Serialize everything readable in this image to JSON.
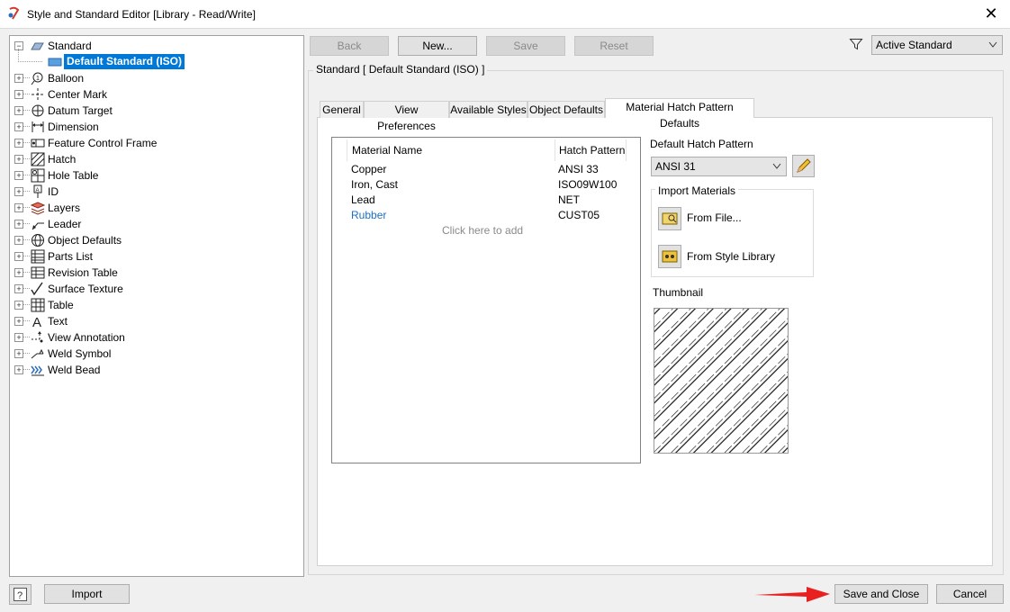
{
  "window": {
    "title": "Style and Standard Editor [Library - Read/Write]",
    "close_glyph": "✕"
  },
  "tree": {
    "root": {
      "label": "Standard",
      "icon": "standard-icon"
    },
    "selected_child": {
      "label": "Default Standard (ISO)",
      "icon": "default-standard-icon"
    },
    "items": [
      {
        "label": "Balloon",
        "icon": "balloon-icon"
      },
      {
        "label": "Center Mark",
        "icon": "center-mark-icon"
      },
      {
        "label": "Datum Target",
        "icon": "datum-target-icon"
      },
      {
        "label": "Dimension",
        "icon": "dimension-icon"
      },
      {
        "label": "Feature Control Frame",
        "icon": "feature-control-frame-icon"
      },
      {
        "label": "Hatch",
        "icon": "hatch-icon"
      },
      {
        "label": "Hole Table",
        "icon": "hole-table-icon"
      },
      {
        "label": "ID",
        "icon": "id-icon"
      },
      {
        "label": "Layers",
        "icon": "layers-icon"
      },
      {
        "label": "Leader",
        "icon": "leader-icon"
      },
      {
        "label": "Object Defaults",
        "icon": "object-defaults-icon"
      },
      {
        "label": "Parts List",
        "icon": "parts-list-icon"
      },
      {
        "label": "Revision Table",
        "icon": "revision-table-icon"
      },
      {
        "label": "Surface Texture",
        "icon": "surface-texture-icon"
      },
      {
        "label": "Table",
        "icon": "table-icon"
      },
      {
        "label": "Text",
        "icon": "text-icon"
      },
      {
        "label": "View Annotation",
        "icon": "view-annotation-icon"
      },
      {
        "label": "Weld Symbol",
        "icon": "weld-symbol-icon"
      },
      {
        "label": "Weld Bead",
        "icon": "weld-bead-icon"
      }
    ]
  },
  "toolbar": {
    "back": "Back",
    "new": "New...",
    "save": "Save",
    "reset": "Reset",
    "filter_value": "Active Standard"
  },
  "panel": {
    "group_title": "Standard [ Default Standard (ISO) ]",
    "tabs": [
      "General",
      "View Preferences",
      "Available Styles",
      "Object Defaults",
      "Material Hatch Pattern Defaults"
    ],
    "active_tab": "Material Hatch Pattern Defaults"
  },
  "materials": {
    "columns": [
      "Material Name",
      "Hatch Pattern"
    ],
    "rows": [
      {
        "name": "Copper",
        "pattern": "ANSI 33"
      },
      {
        "name": "Iron, Cast",
        "pattern": "ISO09W100"
      },
      {
        "name": "Lead",
        "pattern": "NET"
      },
      {
        "name": "Rubber",
        "pattern": "CUST05"
      }
    ],
    "add_hint": "Click here to add",
    "highlight_color": "#1a6fc4"
  },
  "hatch": {
    "default_label": "Default Hatch Pattern",
    "default_value": "ANSI 31",
    "import_label": "Import Materials",
    "from_file": "From File...",
    "from_library": "From Style Library",
    "thumbnail_label": "Thumbnail"
  },
  "footer": {
    "import": "Import",
    "save_close": "Save and Close",
    "cancel": "Cancel"
  },
  "colors": {
    "selection": "#0078d7",
    "arrow": "#e8201f"
  }
}
